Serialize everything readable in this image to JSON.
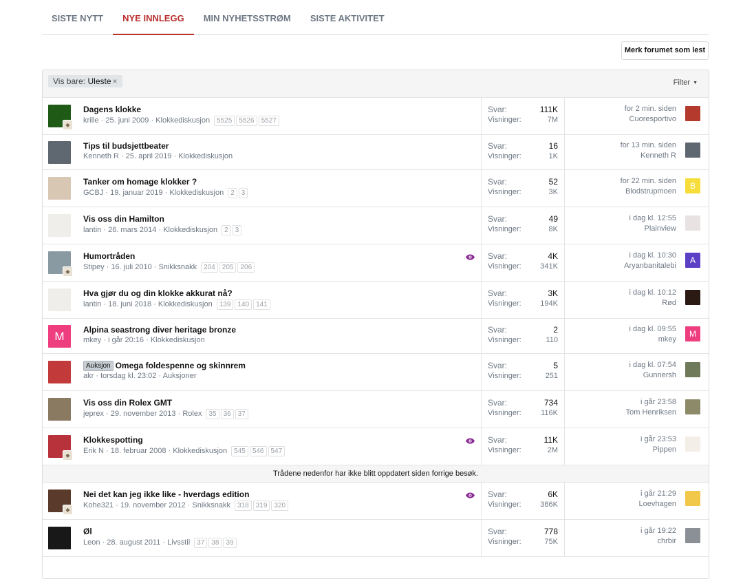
{
  "tabs": [
    "SISTE NYTT",
    "NYE INNLEGG",
    "MIN NYHETSSTRØM",
    "SISTE AKTIVITET"
  ],
  "mark_read": "Merk forumet som lest",
  "filter": {
    "prefix": "Vis bare:",
    "value": "Uleste",
    "remove": "×",
    "button": "Filter"
  },
  "colors": {
    "active_tab": "#b9302d",
    "watch_icon": "#8a2a94",
    "muted": "#6e7884"
  },
  "stats_labels": {
    "replies": "Svar:",
    "views": "Visninger:"
  },
  "divider": "Trådene nedenfor har ikke blitt oppdatert siden forrige besøk.",
  "threads": [
    {
      "title": "Dagens klokke",
      "prefix": "",
      "author": "krille",
      "date": "25. juni 2009",
      "forum": "Klokkediskusjon",
      "pages": [
        "5525",
        "5526",
        "5527"
      ],
      "watched": false,
      "replies": "111K",
      "views": "7M",
      "last_date": "for 2 min. siden",
      "last_user": "Cuoresportivo",
      "avatar": {
        "letter": "",
        "bg": "#1f5a17",
        "sub": true
      },
      "last_avatar": {
        "letter": "",
        "bg": "#b33a2c"
      }
    },
    {
      "title": "Tips til budsjettbeater",
      "prefix": "",
      "author": "Kenneth R",
      "date": "25. april 2019",
      "forum": "Klokkediskusjon",
      "pages": [],
      "watched": false,
      "replies": "16",
      "views": "1K",
      "last_date": "for 13 min. siden",
      "last_user": "Kenneth R",
      "avatar": {
        "letter": "",
        "bg": "#5f6770",
        "sub": false
      },
      "last_avatar": {
        "letter": "",
        "bg": "#5f6770"
      }
    },
    {
      "title": "Tanker om homage klokker ?",
      "prefix": "",
      "author": "GCBJ",
      "date": "19. januar 2019",
      "forum": "Klokkediskusjon",
      "pages": [
        "2",
        "3"
      ],
      "watched": false,
      "replies": "52",
      "views": "3K",
      "last_date": "for 22 min. siden",
      "last_user": "Blodstrupmoen",
      "avatar": {
        "letter": "",
        "bg": "#d8c7b3",
        "sub": false
      },
      "last_avatar": {
        "letter": "B",
        "bg": "#f6dd39"
      }
    },
    {
      "title": "Vis oss din Hamilton",
      "prefix": "",
      "author": "lantin",
      "date": "26. mars 2014",
      "forum": "Klokkediskusjon",
      "pages": [
        "2",
        "3"
      ],
      "watched": false,
      "replies": "49",
      "views": "8K",
      "last_date": "i dag kl. 12:55",
      "last_user": "Plainview",
      "avatar": {
        "letter": "",
        "bg": "#f0eeea",
        "sub": false
      },
      "last_avatar": {
        "letter": "",
        "bg": "#e8e2e2"
      }
    },
    {
      "title": "Humortråden",
      "prefix": "",
      "author": "Stipey",
      "date": "16. juli 2010",
      "forum": "Snikksnakk",
      "pages": [
        "204",
        "205",
        "206"
      ],
      "watched": true,
      "replies": "4K",
      "views": "341K",
      "last_date": "i dag kl. 10:30",
      "last_user": "Aryanbanitalebi",
      "avatar": {
        "letter": "",
        "bg": "#8a9aa3",
        "sub": true
      },
      "last_avatar": {
        "letter": "A",
        "bg": "#5b3fc4"
      }
    },
    {
      "title": "Hva gjør du og din klokke akkurat nå?",
      "prefix": "",
      "author": "lantin",
      "date": "18. juni 2018",
      "forum": "Klokkediskusjon",
      "pages": [
        "139",
        "140",
        "141"
      ],
      "watched": false,
      "replies": "3K",
      "views": "194K",
      "last_date": "i dag kl. 10:12",
      "last_user": "Rød",
      "avatar": {
        "letter": "",
        "bg": "#f0eeea",
        "sub": false
      },
      "last_avatar": {
        "letter": "",
        "bg": "#2b1a14"
      }
    },
    {
      "title": "Alpina seastrong diver heritage bronze",
      "prefix": "",
      "author": "mkey",
      "date": "i går 20:16",
      "forum": "Klokkediskusjon",
      "pages": [],
      "watched": false,
      "replies": "2",
      "views": "110",
      "last_date": "i dag kl. 09:55",
      "last_user": "mkey",
      "avatar": {
        "letter": "M",
        "bg": "#ee3e80"
      },
      "last_avatar": {
        "letter": "M",
        "bg": "#ee3e80"
      }
    },
    {
      "title": "Omega foldespenne og skinnrem",
      "prefix": "Auksjon",
      "author": "akr",
      "date": "torsdag kl. 23:02",
      "forum": "Auksjoner",
      "pages": [],
      "watched": false,
      "replies": "5",
      "views": "251",
      "last_date": "i dag kl. 07:54",
      "last_user": "Gunnersh",
      "avatar": {
        "letter": "",
        "bg": "#c23a3a",
        "sub": false
      },
      "last_avatar": {
        "letter": "",
        "bg": "#6f7a5a"
      }
    },
    {
      "title": "Vis oss din Rolex GMT",
      "prefix": "",
      "author": "jeprex",
      "date": "29. november 2013",
      "forum": "Rolex",
      "pages": [
        "35",
        "36",
        "37"
      ],
      "watched": false,
      "replies": "734",
      "views": "116K",
      "last_date": "i går 23:58",
      "last_user": "Tom Henriksen",
      "avatar": {
        "letter": "",
        "bg": "#8b7a62",
        "sub": false
      },
      "last_avatar": {
        "letter": "",
        "bg": "#8d8a6a"
      }
    },
    {
      "title": "Klokkespotting",
      "prefix": "",
      "author": "Erik N",
      "date": "18. februar 2008",
      "forum": "Klokkediskusjon",
      "pages": [
        "545",
        "546",
        "547"
      ],
      "watched": true,
      "replies": "11K",
      "views": "2M",
      "last_date": "i går 23:53",
      "last_user": "Pippen",
      "avatar": {
        "letter": "",
        "bg": "#b8323c",
        "sub": true
      },
      "last_avatar": {
        "letter": "",
        "bg": "#f3eee8"
      }
    },
    {
      "title": "Nei det kan jeg ikke like - hverdags edition",
      "prefix": "",
      "author": "Kohe321",
      "date": "19. november 2012",
      "forum": "Snikksnakk",
      "pages": [
        "318",
        "319",
        "320"
      ],
      "watched": true,
      "replies": "6K",
      "views": "386K",
      "last_date": "i går 21:29",
      "last_user": "Loevhagen",
      "avatar": {
        "letter": "",
        "bg": "#5a3a2a",
        "sub": true
      },
      "last_avatar": {
        "letter": "",
        "bg": "#f2c84a"
      }
    },
    {
      "title": "Øl",
      "prefix": "",
      "author": "Leon",
      "date": "28. august 2011",
      "forum": "Livsstil",
      "pages": [
        "37",
        "38",
        "39"
      ],
      "watched": false,
      "replies": "778",
      "views": "75K",
      "last_date": "i går 19:22",
      "last_user": "chrbir",
      "avatar": {
        "letter": "",
        "bg": "#181818",
        "sub": false
      },
      "last_avatar": {
        "letter": "",
        "bg": "#8a9095"
      }
    }
  ]
}
